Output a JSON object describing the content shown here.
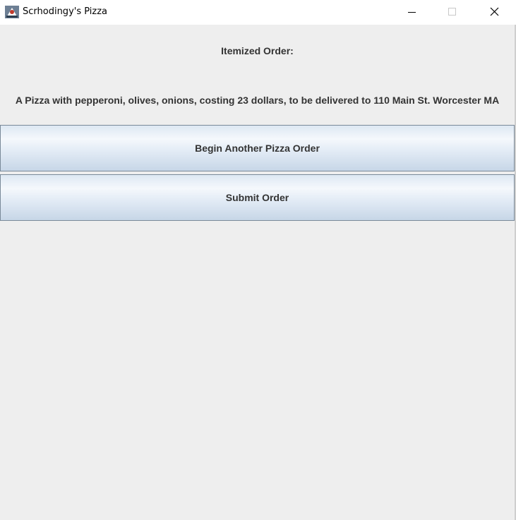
{
  "window": {
    "title": "Scrhodingy's Pizza",
    "icon": "java-app-icon",
    "controls": [
      "minimize-icon",
      "maximize-icon",
      "close-icon"
    ]
  },
  "main": {
    "header": "Itemized Order:",
    "order_summary": "A Pizza with pepperoni, olives, onions,  costing 23 dollars, to be delivered to 110 Main St. Worcester MA",
    "buttons": {
      "begin_another": "Begin Another Pizza Order",
      "submit": "Submit Order"
    }
  },
  "colors": {
    "background": "#eeeeee",
    "text": "#333333",
    "button_border": "#7a8a99"
  }
}
